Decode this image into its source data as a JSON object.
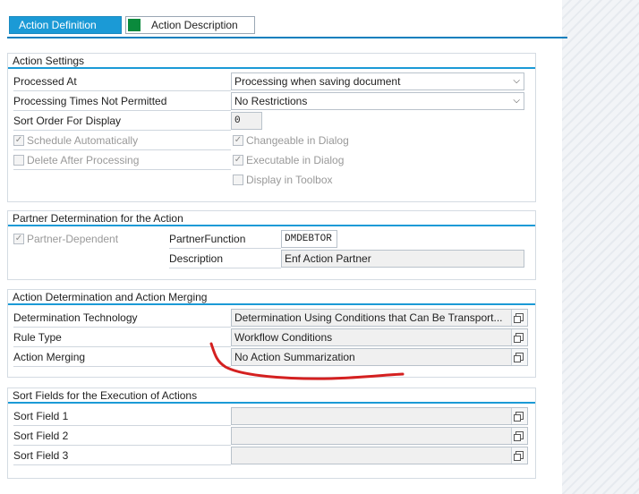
{
  "tabs": [
    {
      "label": "Action Definition",
      "active": true
    },
    {
      "label": "Action Description",
      "active": false,
      "status_color": "#0a8a3c"
    }
  ],
  "action_settings": {
    "title": "Action Settings",
    "processed_at_label": "Processed At",
    "processed_at_value": "Processing when saving document",
    "times_not_permitted_label": "Processing Times Not Permitted",
    "times_not_permitted_value": "No Restrictions",
    "sort_order_label": "Sort Order For Display",
    "sort_order_value": "0",
    "schedule_auto": {
      "label": "Schedule Automatically",
      "checked": true
    },
    "delete_after": {
      "label": "Delete After Processing",
      "checked": false
    },
    "changeable_dialog": {
      "label": "Changeable in Dialog",
      "checked": true
    },
    "executable_dialog": {
      "label": "Executable in Dialog",
      "checked": true
    },
    "display_toolbox": {
      "label": "Display in Toolbox",
      "checked": false
    }
  },
  "partner": {
    "title": "Partner Determination for the Action",
    "partner_dependent": {
      "label": "Partner-Dependent",
      "checked": true
    },
    "function_label": "PartnerFunction",
    "function_value": "DMDEBTOR",
    "description_label": "Description",
    "description_value": "Enf Action Partner"
  },
  "determination": {
    "title": "Action Determination and Action Merging",
    "technology_label": "Determination Technology",
    "technology_value": "Determination Using Conditions that Can Be Transport...",
    "rule_type_label": "Rule Type",
    "rule_type_value": "Workflow Conditions",
    "merging_label": "Action Merging",
    "merging_value": "No Action Summarization"
  },
  "sort_fields": {
    "title": "Sort Fields for the Execution of Actions",
    "field1_label": "Sort Field 1",
    "field1_value": "",
    "field2_label": "Sort Field 2",
    "field2_value": "",
    "field3_label": "Sort Field 3",
    "field3_value": ""
  },
  "colors": {
    "accent": "#1b9ad6",
    "annotation": "#d42020"
  },
  "icons": {
    "dropdown": "chevron-down-icon",
    "value_help": "value-help-icon",
    "check": "checkmark-icon"
  }
}
